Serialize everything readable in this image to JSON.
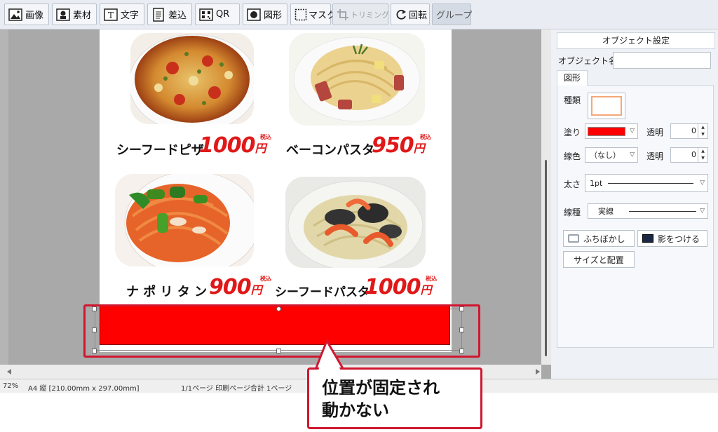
{
  "toolbar": {
    "buttons": [
      {
        "label": "画像",
        "icon": "image-icon"
      },
      {
        "label": "素材",
        "icon": "material-icon"
      },
      {
        "label": "文字",
        "icon": "text-icon"
      },
      {
        "label": "差込",
        "icon": "insert-icon"
      },
      {
        "label": "QR",
        "icon": "qr-icon"
      },
      {
        "label": "図形",
        "icon": "shape-icon"
      },
      {
        "label": "マスク",
        "icon": "mask-icon"
      },
      {
        "label": "トリミング",
        "icon": "crop-icon",
        "disabled": true
      },
      {
        "label": "回転",
        "icon": "rotate-icon"
      },
      {
        "label": "グループ",
        "icon": "",
        "pressed": true
      }
    ]
  },
  "menu": {
    "items": [
      {
        "name": "シーフードピザ",
        "price": "1000",
        "yen": "円",
        "tax": "税込"
      },
      {
        "name": "ベーコンパスタ",
        "price": "950",
        "yen": "円",
        "tax": "税込"
      },
      {
        "name": "ナ ポ リ タ ン",
        "price": "900",
        "yen": "円",
        "tax": "税込"
      },
      {
        "name": "シーフードパスタ",
        "price": "1000",
        "yen": "円",
        "tax": "税込"
      }
    ]
  },
  "panel": {
    "title": "オブジェクト設定",
    "object_name_label": "オブジェクト名",
    "object_name_value": "",
    "tab": "図形",
    "type_label": "種類",
    "fill_label": "塗り",
    "fill_color": "#ff0000",
    "fill_transparency_label": "透明",
    "fill_transparency": "0",
    "line_color_label": "線色",
    "line_color_value": "（なし）",
    "line_transparency_label": "透明",
    "line_transparency": "0",
    "thickness_label": "太さ",
    "thickness_value": "1pt",
    "line_type_label": "線種",
    "line_type_value": "実線",
    "blur_button": "ふちぼかし",
    "shadow_button": "影をつける",
    "size_button": "サイズと配置"
  },
  "status": {
    "zoom": "72%",
    "paper": "A4 縦 [210.00mm x 297.00mm]",
    "pages": "1/1ページ 印刷ページ合計 1ページ"
  },
  "callout": {
    "text": "位置が固定され\n動かない"
  },
  "colors": {
    "accent": "#d0172f",
    "price": "#e01818",
    "shape_fill": "#ff0000"
  }
}
